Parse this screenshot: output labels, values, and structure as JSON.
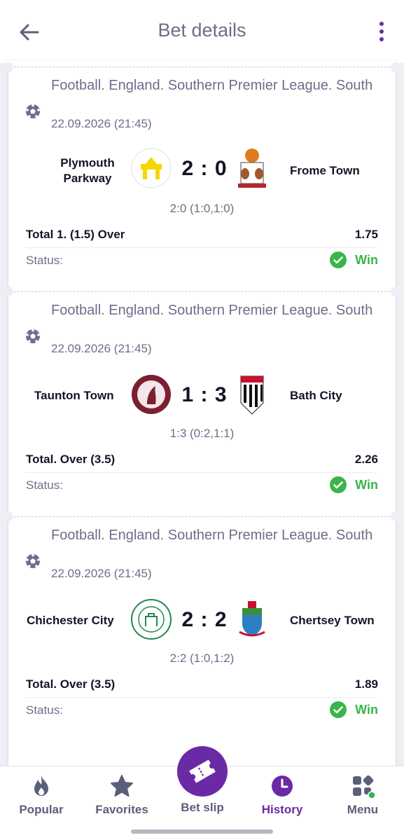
{
  "header": {
    "title": "Bet details",
    "back_icon": "arrow-left-icon",
    "menu_icon": "kebab-menu-icon"
  },
  "colors": {
    "accent": "#6a2aa6",
    "win": "#39b54a",
    "muted": "#6b6f89"
  },
  "bets": [
    {
      "league": "Football. England. Southern Premier League. South",
      "date": "22.09.2026 (21:45)",
      "home": "Plymouth Parkway",
      "away": "Frome Town",
      "score": "2 : 0",
      "detail": "2:0 (1:0,1:0)",
      "market": "Total 1. (1.5) Over",
      "odds": "1.75",
      "status_label": "Status:",
      "status": "Win"
    },
    {
      "league": "Football. England. Southern Premier League. South",
      "date": "22.09.2026 (21:45)",
      "home": "Taunton Town",
      "away": "Bath City",
      "score": "1 : 3",
      "detail": "1:3 (0:2,1:1)",
      "market": "Total. Over (3.5)",
      "odds": "2.26",
      "status_label": "Status:",
      "status": "Win"
    },
    {
      "league": "Football. England. Southern Premier League. South",
      "date": "22.09.2026 (21:45)",
      "home": "Chichester City",
      "away": "Chertsey Town",
      "score": "2 : 2",
      "detail": "2:2 (1:0,1:2)",
      "market": "Total. Over (3.5)",
      "odds": "1.89",
      "status_label": "Status:",
      "status": "Win"
    }
  ],
  "nav": {
    "popular": "Popular",
    "favorites": "Favorites",
    "betslip": "Bet slip",
    "history": "History",
    "menu": "Menu",
    "active": "history"
  }
}
